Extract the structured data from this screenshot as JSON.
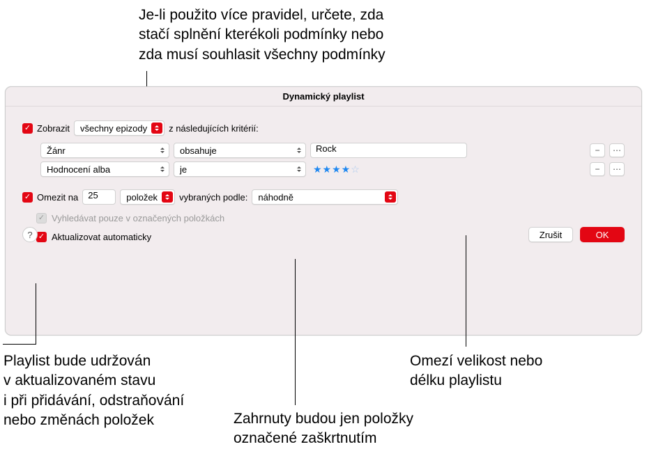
{
  "annotations": {
    "top": "Je-li použito více pravidel, určete, zda\nstačí splnění kterékoli podmínky nebo\nzda musí souhlasit všechny podmínky",
    "bottom_left": "Playlist bude udržován\nv aktualizovaném stavu\ni při přidávání, odstraňování\nnebo změnách položek",
    "bottom_mid": "Zahrnuty budou jen položky\noznačené zaškrtnutím",
    "bottom_right": "Omezí velikost nebo\ndélku playlistu"
  },
  "dialog": {
    "title": "Dynamický playlist",
    "show_label": "Zobrazit",
    "match_mode": "všechny epizody",
    "criteria_suffix": "z následujících kritérií:",
    "rules": [
      {
        "field": "Žánr",
        "op": "obsahuje",
        "value": "Rock",
        "type": "text"
      },
      {
        "field": "Hodnocení alba",
        "op": "je",
        "value": 4,
        "type": "stars"
      }
    ],
    "limit": {
      "label": "Omezit na",
      "value": "25",
      "unit": "položek",
      "by_label": "vybraných podle:",
      "by_value": "náhodně"
    },
    "only_checked_label": "Vyhledávat pouze v označených položkách",
    "live_update_label": "Aktualizovat automaticky",
    "buttons": {
      "cancel": "Zrušit",
      "ok": "OK",
      "help": "?"
    }
  }
}
